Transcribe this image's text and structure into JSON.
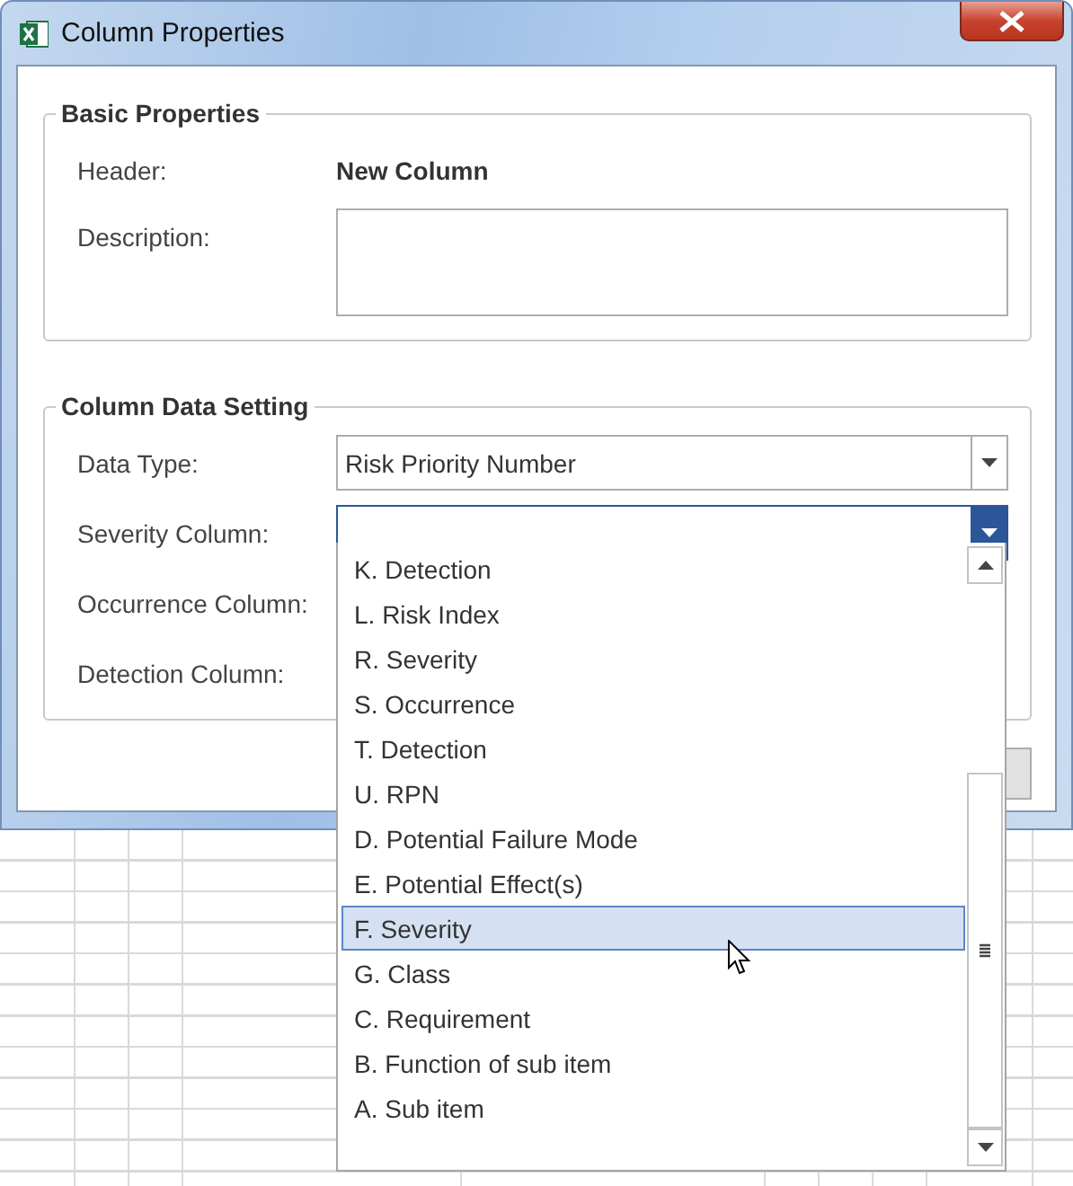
{
  "window": {
    "title": "Column Properties"
  },
  "basic_properties": {
    "title": "Basic Properties",
    "fields": [
      {
        "kind": "text",
        "label": "Header:",
        "value": "New Column"
      },
      {
        "kind": "textarea",
        "label": "Description:"
      }
    ]
  },
  "column_data_setting": {
    "title": "Column Data Setting",
    "fields": [
      {
        "kind": "combo",
        "label": "Data Type:",
        "value": "Risk Priority Number",
        "focused": false,
        "expanded": false
      },
      {
        "kind": "combo",
        "label": "Severity Column:",
        "focused": true,
        "expanded": true
      },
      {
        "kind": "covered",
        "label": "Occurrence Column:"
      },
      {
        "kind": "covered",
        "label": "Detection Column:"
      }
    ]
  },
  "dropdown": {
    "items": [
      {
        "label": "K. Detection",
        "selected": false
      },
      {
        "label": "L. Risk Index",
        "selected": false
      },
      {
        "label": "R. Severity",
        "selected": false
      },
      {
        "label": "S. Occurrence",
        "selected": false
      },
      {
        "label": "T. Detection",
        "selected": false
      },
      {
        "label": "U. RPN",
        "selected": false
      },
      {
        "label": "D. Potential Failure Mode",
        "selected": false
      },
      {
        "label": "E. Potential Effect(s)",
        "selected": false
      },
      {
        "label": "F. Severity",
        "selected": true
      },
      {
        "label": "G. Class",
        "selected": false
      },
      {
        "label": "C. Requirement",
        "selected": false
      },
      {
        "label": "B. Function of sub item",
        "selected": false
      },
      {
        "label": "A. Sub item",
        "selected": false
      }
    ]
  }
}
